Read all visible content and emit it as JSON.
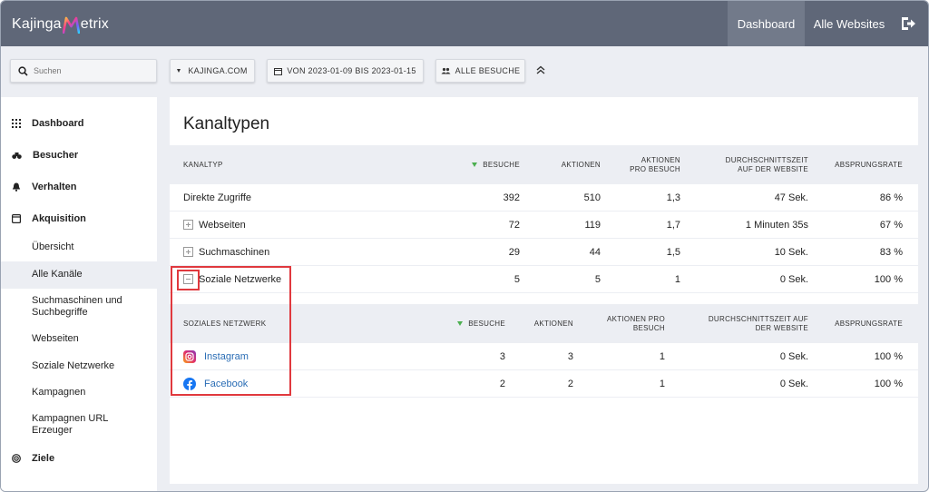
{
  "header": {
    "logo_prefix": "Kajinga",
    "logo_suffix": "etrix",
    "nav": {
      "dashboard": "Dashboard",
      "all_websites": "Alle Websites"
    }
  },
  "filters": {
    "search_placeholder": "Suchen",
    "site": "KAJINGA.COM",
    "date_range": "VON 2023-01-09 BIS 2023-01-15",
    "segment": "ALLE BESUCHE"
  },
  "sidebar": {
    "items": [
      {
        "label": "Dashboard",
        "icon": "grid-icon"
      },
      {
        "label": "Besucher",
        "icon": "binoculars-icon"
      },
      {
        "label": "Verhalten",
        "icon": "bell-icon"
      },
      {
        "label": "Akquisition",
        "icon": "window-icon"
      }
    ],
    "sub_items": [
      {
        "label": "Übersicht"
      },
      {
        "label": "Alle Kanäle"
      },
      {
        "label": "Suchmaschinen und Suchbegriffe"
      },
      {
        "label": "Webseiten"
      },
      {
        "label": "Soziale Netzwerke"
      },
      {
        "label": "Kampagnen"
      },
      {
        "label": "Kampagnen URL Erzeuger"
      }
    ],
    "goals": {
      "label": "Ziele",
      "icon": "target-icon"
    }
  },
  "report": {
    "title": "Kanaltypen",
    "columns": [
      "KANALTYP",
      "BESUCHE",
      "AKTIONEN",
      "AKTIONEN PRO BESUCH",
      "DURCHSCHNITTSZEIT AUF DER WEBSITE",
      "ABSPRUNGSRATE"
    ],
    "column_lines": {
      "apb": [
        "AKTIONEN",
        "PRO BESUCH"
      ],
      "avg": [
        "DURCHSCHNITTSZEIT",
        "AUF DER WEBSITE"
      ]
    },
    "rows": [
      {
        "name": "Direkte Zugriffe",
        "visits": "392",
        "actions": "510",
        "apv": "1,3",
        "avg": "47 Sek.",
        "bounce": "86 %",
        "expander": "none"
      },
      {
        "name": "Webseiten",
        "visits": "72",
        "actions": "119",
        "apv": "1,7",
        "avg": "1 Minuten 35s",
        "bounce": "67 %",
        "expander": "plus"
      },
      {
        "name": "Suchmaschinen",
        "visits": "29",
        "actions": "44",
        "apv": "1,5",
        "avg": "10 Sek.",
        "bounce": "83 %",
        "expander": "plus"
      },
      {
        "name": "Soziale Netzwerke",
        "visits": "5",
        "actions": "5",
        "apv": "1",
        "avg": "0 Sek.",
        "bounce": "100 %",
        "expander": "minus"
      }
    ],
    "subtable": {
      "columns": [
        "SOZIALES NETZWERK",
        "BESUCHE",
        "AKTIONEN",
        "AKTIONEN PRO BESUCH",
        "DURCHSCHNITTSZEIT AUF DER WEBSITE",
        "ABSPRUNGSRATE"
      ],
      "column_lines": {
        "apb": [
          "AKTIONEN PRO",
          "BESUCH"
        ],
        "avg": [
          "DURCHSCHNITTSZEIT AUF",
          "DER WEBSITE"
        ]
      },
      "rows": [
        {
          "name": "Instagram",
          "icon": "instagram-icon",
          "visits": "3",
          "actions": "3",
          "apv": "1",
          "avg": "0 Sek.",
          "bounce": "100 %"
        },
        {
          "name": "Facebook",
          "icon": "facebook-icon",
          "visits": "2",
          "actions": "2",
          "apv": "1",
          "avg": "0 Sek.",
          "bounce": "100 %"
        }
      ]
    }
  },
  "colors": {
    "topbar": "#5f6778",
    "highlight_box": "#e0393e",
    "link": "#2a6db5",
    "sort_indicator": "#4caf50"
  }
}
